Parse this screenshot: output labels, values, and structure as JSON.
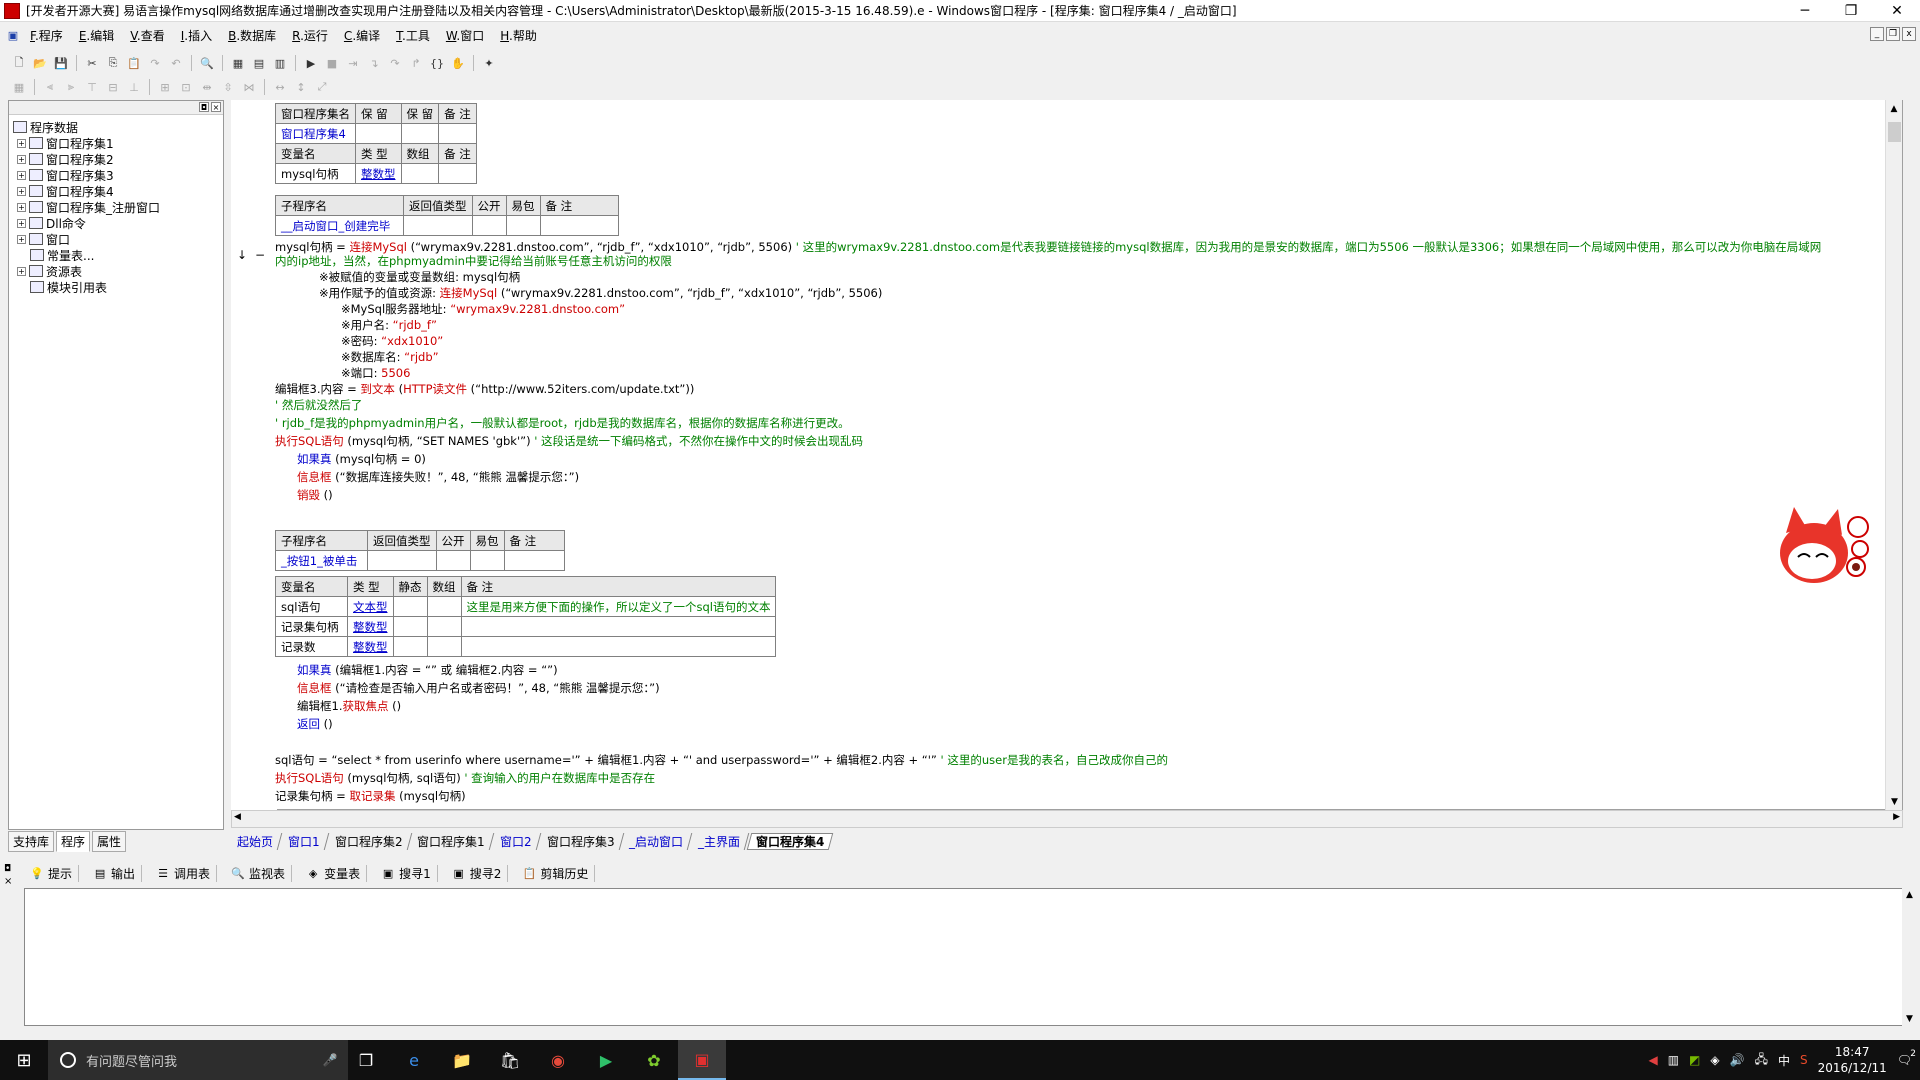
{
  "window": {
    "title": "[开发者开源大赛] 易语言操作mysql网络数据库通过增删改查实现用户注册登陆以及相关内容管理 - C:\\Users\\Administrator\\Desktop\\最新版(2015-3-15 16.48.59).e - Windows窗口程序 - [程序集: 窗口程序集4 / _启动窗口]",
    "minimize": "─",
    "maximize": "❐",
    "close": "✕"
  },
  "menu": [
    {
      "key": "F",
      "label": ".程序"
    },
    {
      "key": "E",
      "label": ".编辑"
    },
    {
      "key": "V",
      "label": ".查看"
    },
    {
      "key": "I",
      "label": ".插入"
    },
    {
      "key": "B",
      "label": ".数据库"
    },
    {
      "key": "R",
      "label": ".运行"
    },
    {
      "key": "C",
      "label": ".编译"
    },
    {
      "key": "T",
      "label": ".工具"
    },
    {
      "key": "W",
      "label": ".窗口"
    },
    {
      "key": "H",
      "label": ".帮助"
    }
  ],
  "tree": {
    "root": "程序数据",
    "items": [
      "窗口程序集1",
      "窗口程序集2",
      "窗口程序集3",
      "窗口程序集4",
      "窗口程序集_注册窗口",
      "Dll命令",
      "窗口",
      "常量表...",
      "资源表",
      "模块引用表"
    ]
  },
  "left_tabs": [
    "支持库",
    "程序",
    "属性"
  ],
  "table1": {
    "header": [
      "窗口程序集名",
      "保 留",
      "保 留",
      "备 注"
    ],
    "row": [
      "窗口程序集4",
      "",
      "",
      ""
    ],
    "var_header": [
      "变量名",
      "类 型",
      "数组",
      "备 注"
    ],
    "var_row": [
      "mysql句柄",
      "整数型",
      "",
      ""
    ]
  },
  "table2": {
    "header": [
      "子程序名",
      "返回值类型",
      "公开",
      "易包",
      "备 注"
    ],
    "row": [
      "__启动窗口_创建完毕",
      "",
      "",
      "",
      ""
    ]
  },
  "code1": {
    "l1_pre": "mysql句柄 = ",
    "l1_fn": "连接MySql",
    "l1_args": " (“wrymax9v.2281.dnstoo.com”, “rjdb_f”, “xdx1010”, “rjdb”, 5506)",
    "l1_cmt": " ' 这里的wrymax9v.2281.dnstoo.com是代表我要链接链接的mysql数据库，因为我用的是景安的数据库，端口为5506 一般默认是3306；如果想在同一个局域网中使用，那么可以改为你电脑在局域网",
    "l2_cmt": "内的ip地址，当然，在phpmyadmin中要记得给当前账号任意主机访问的权限",
    "l3": "※被赋值的变量或变量数组: mysql句柄",
    "l4_pre": "※用作赋予的值或资源: ",
    "l4_fn": "连接MySql",
    "l4_args": " (“wrymax9v.2281.dnstoo.com”, “rjdb_f”, “xdx1010”, “rjdb”, 5506)",
    "l5_pre": "※MySql服务器地址: ",
    "l5_val": "“wrymax9v.2281.dnstoo.com”",
    "l6_pre": "※用户名: ",
    "l6_val": "“rjdb_f”",
    "l7_pre": "※密码: ",
    "l7_val": "“xdx1010”",
    "l8_pre": "※数据库名: ",
    "l8_val": "“rjdb”",
    "l9_pre": "※端口: ",
    "l9_val": "5506",
    "l10_pre": "编辑框3.内容 = ",
    "l10_fn": "到文本",
    "l10_mid": " (",
    "l10_fn2": "HTTP读文件",
    "l10_args": " (“http://www.52iters.com/update.txt”))",
    "l11_cmt": "' 然后就没然后了",
    "l12_cmt": "' rjdb_f是我的phpmyadmin用户名，一般默认都是root，rjdb是我的数据库名，根据你的数据库名称进行更改。",
    "l13_fn": "执行SQL语句",
    "l13_args": " (mysql句柄, “SET NAMES 'gbk'”)",
    "l13_cmt": " ' 这段话是统一下编码格式，不然你在操作中文的时候会出现乱码",
    "l14_kw": "如果真",
    "l14_args": " (mysql句柄 = 0)",
    "l15_fn": "信息框",
    "l15_args": " (“数据库连接失败！”, 48, “熊熊 温馨提示您：”)",
    "l16_fn": "销毁",
    "l16_args": " ()"
  },
  "table3": {
    "header": [
      "子程序名",
      "返回值类型",
      "公开",
      "易包",
      "备 注"
    ],
    "row": [
      "_按钮1_被单击",
      "",
      "",
      "",
      ""
    ]
  },
  "table4": {
    "header": [
      "变量名",
      "类 型",
      "静态",
      "数组",
      "备 注"
    ],
    "rows": [
      [
        "sql语句",
        "文本型",
        "",
        "",
        "这里是用来方便下面的操作，所以定义了一个sql语句的文本"
      ],
      [
        "记录集句柄",
        "整数型",
        "",
        "",
        ""
      ],
      [
        "记录数",
        "整数型",
        "",
        "",
        ""
      ]
    ]
  },
  "code2": {
    "l1_kw": "如果真",
    "l1_args": " (编辑框1.内容 = “” 或 编辑框2.内容 = “”)",
    "l2_fn": "信息框",
    "l2_args": " (“请检查是否输入用户名或者密码！”, 48, “熊熊 温馨提示您：”)",
    "l3_pre": "编辑框1.",
    "l3_fn": "获取焦点",
    "l3_args": " ()",
    "l4_fn": "返回",
    "l4_args": " ()",
    "l5_pre": "sql语句 = ",
    "l5_args": "“select * from userinfo where  username='” + 编辑框1.内容 + “' and userpassword='” + 编辑框2.内容 + “'”",
    "l5_cmt": " ' 这里的user是我的表名，自己改成你自己的",
    "l6_fn": "执行SQL语句",
    "l6_args": " (mysql句柄, sql语句)",
    "l6_cmt": " ' 查询输入的用户在数据库中是否存在",
    "l7_pre": "记录集句柄 = ",
    "l7_fn": "取记录集",
    "l7_args": " (mysql句柄)"
  },
  "doc_tabs": [
    {
      "label": "起始页",
      "blue": true
    },
    {
      "label": "窗口1",
      "blue": true
    },
    {
      "label": "窗口程序集2",
      "blue": false
    },
    {
      "label": "窗口程序集1",
      "blue": false
    },
    {
      "label": "窗口2",
      "blue": true
    },
    {
      "label": "窗口程序集3",
      "blue": false
    },
    {
      "label": "_启动窗口",
      "blue": true
    },
    {
      "label": "_主界面",
      "blue": true
    },
    {
      "label": "窗口程序集4",
      "blue": false,
      "active": true
    }
  ],
  "bottom_tabs": [
    "提示",
    "输出",
    "调用表",
    "监视表",
    "变量表",
    "搜寻1",
    "搜寻2",
    "剪辑历史"
  ],
  "taskbar": {
    "search_placeholder": "有问题尽管问我",
    "time": "18:47",
    "date": "2016/12/11",
    "ime": "中",
    "notif": "2"
  }
}
